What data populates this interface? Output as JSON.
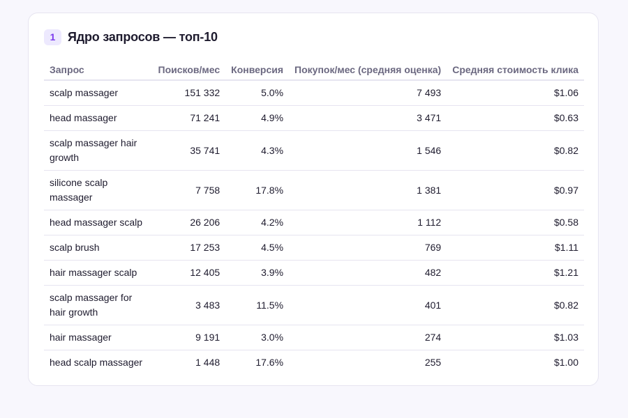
{
  "section": {
    "number": "1",
    "title": "Ядро запросов — топ-10"
  },
  "table": {
    "columns": [
      "Запрос",
      "Поисков/мес",
      "Конверсия",
      "Покупок/мес (средняя оценка)",
      "Средняя стоимость клика"
    ],
    "rows": [
      {
        "query": "scalp massager",
        "searches": "151 332",
        "conversion": "5.0%",
        "purchases": "7 493",
        "cpc": "$1.06"
      },
      {
        "query": "head massager",
        "searches": "71 241",
        "conversion": "4.9%",
        "purchases": "3 471",
        "cpc": "$0.63"
      },
      {
        "query": "scalp massager hair growth",
        "searches": "35 741",
        "conversion": "4.3%",
        "purchases": "1 546",
        "cpc": "$0.82"
      },
      {
        "query": "silicone scalp massager",
        "searches": "7 758",
        "conversion": "17.8%",
        "purchases": "1 381",
        "cpc": "$0.97"
      },
      {
        "query": "head massager scalp",
        "searches": "26 206",
        "conversion": "4.2%",
        "purchases": "1 112",
        "cpc": "$0.58"
      },
      {
        "query": "scalp brush",
        "searches": "17 253",
        "conversion": "4.5%",
        "purchases": "769",
        "cpc": "$1.11"
      },
      {
        "query": "hair massager scalp",
        "searches": "12 405",
        "conversion": "3.9%",
        "purchases": "482",
        "cpc": "$1.21"
      },
      {
        "query": "scalp massager for hair growth",
        "searches": "3 483",
        "conversion": "11.5%",
        "purchases": "401",
        "cpc": "$0.82"
      },
      {
        "query": "hair massager",
        "searches": "9 191",
        "conversion": "3.0%",
        "purchases": "274",
        "cpc": "$1.03"
      },
      {
        "query": "head scalp massager",
        "searches": "1 448",
        "conversion": "17.6%",
        "purchases": "255",
        "cpc": "$1.00"
      }
    ]
  }
}
